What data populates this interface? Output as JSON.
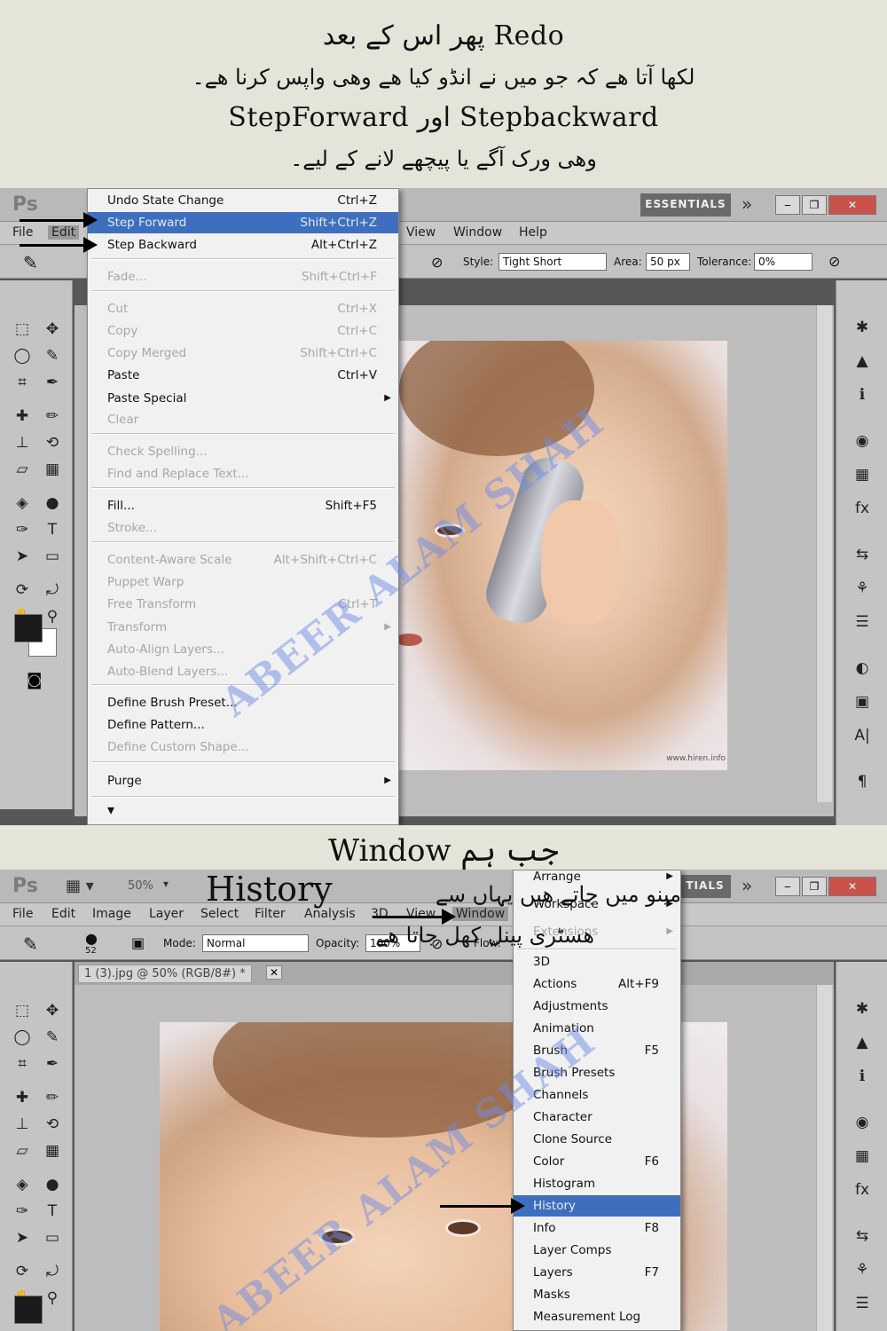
{
  "banner_top": {
    "line1": "Redo پھر اس کے بعد",
    "line2": "لکھا آتا ھے کہ جو میں نے انڈو کیا ھے وھی واپس کرنا ھے۔",
    "line3": "Stepbackward اور StepForward",
    "line4": "وھی ورک آگے یا پیچھے لانے کے لیے۔"
  },
  "screen1": {
    "app_logo": "Ps",
    "menubar": [
      "File",
      "Edit",
      "View",
      "Window",
      "Help"
    ],
    "workspace_button": "ESSENTIALS",
    "options_bar": {
      "style_label": "Style:",
      "style_value": "Tight Short",
      "area_label": "Area:",
      "area_value": "50 px",
      "tolerance_label": "Tolerance:",
      "tolerance_value": "0%"
    },
    "edit_menu": [
      {
        "label": "Undo State Change",
        "shortcut": "Ctrl+Z",
        "state": "normal"
      },
      {
        "label": "Step Forward",
        "shortcut": "Shift+Ctrl+Z",
        "state": "selected"
      },
      {
        "label": "Step Backward",
        "shortcut": "Alt+Ctrl+Z",
        "state": "normal"
      },
      {
        "label": "Fade...",
        "shortcut": "Shift+Ctrl+F",
        "state": "disabled"
      },
      {
        "label": "Cut",
        "shortcut": "Ctrl+X",
        "state": "disabled"
      },
      {
        "label": "Copy",
        "shortcut": "Ctrl+C",
        "state": "disabled"
      },
      {
        "label": "Copy Merged",
        "shortcut": "Shift+Ctrl+C",
        "state": "disabled"
      },
      {
        "label": "Paste",
        "shortcut": "Ctrl+V",
        "state": "normal"
      },
      {
        "label": "Paste Special",
        "shortcut": "",
        "state": "normal",
        "submenu": true
      },
      {
        "label": "Clear",
        "shortcut": "",
        "state": "disabled"
      },
      {
        "label": "Check Spelling...",
        "shortcut": "",
        "state": "disabled"
      },
      {
        "label": "Find and Replace Text...",
        "shortcut": "",
        "state": "disabled"
      },
      {
        "label": "Fill...",
        "shortcut": "Shift+F5",
        "state": "normal"
      },
      {
        "label": "Stroke...",
        "shortcut": "",
        "state": "disabled"
      },
      {
        "label": "Content-Aware Scale",
        "shortcut": "Alt+Shift+Ctrl+C",
        "state": "disabled"
      },
      {
        "label": "Puppet Warp",
        "shortcut": "",
        "state": "disabled"
      },
      {
        "label": "Free Transform",
        "shortcut": "Ctrl+T",
        "state": "disabled"
      },
      {
        "label": "Transform",
        "shortcut": "",
        "state": "disabled",
        "submenu": true
      },
      {
        "label": "Auto-Align Layers...",
        "shortcut": "",
        "state": "disabled"
      },
      {
        "label": "Auto-Blend Layers...",
        "shortcut": "",
        "state": "disabled"
      },
      {
        "label": "Define Brush Preset...",
        "shortcut": "",
        "state": "normal"
      },
      {
        "label": "Define Pattern...",
        "shortcut": "",
        "state": "normal"
      },
      {
        "label": "Define Custom Shape...",
        "shortcut": "",
        "state": "disabled"
      },
      {
        "label": "Purge",
        "shortcut": "",
        "state": "normal",
        "submenu": true
      }
    ],
    "watermark": "ABEER ALAM SHAH",
    "credit": "www.hiren.info"
  },
  "banner_middle": {
    "title": "جب ہم Window",
    "overlay1": "History",
    "overlay2": "مینو میں جاتے ھیں یہاں سے",
    "overlay3": "ھسٹری پینل کھل جاتا ھے"
  },
  "screen2": {
    "app_logo": "Ps",
    "zoom": "50%",
    "menubar": [
      "File",
      "Edit",
      "Image",
      "Layer",
      "Select",
      "Filter",
      "Analysis",
      "3D",
      "View",
      "Window"
    ],
    "workspace_button": "TIALS",
    "options_bar": {
      "brush_size": "52",
      "mode_label": "Mode:",
      "mode_value": "Normal",
      "opacity_label": "Opacity:",
      "opacity_value": "100%",
      "flow_label": "Flow:"
    },
    "doc_tab": "1 (3).jpg @ 50% (RGB/8#) *",
    "window_menu": [
      {
        "label": "Arrange",
        "shortcut": "",
        "submenu": true,
        "state": "normal"
      },
      {
        "label": "Workspace",
        "shortcut": "",
        "submenu": true,
        "state": "normal"
      },
      {
        "label": "Extensions",
        "shortcut": "",
        "submenu": true,
        "state": "disabled"
      },
      {
        "label": "3D",
        "shortcut": "",
        "state": "normal"
      },
      {
        "label": "Actions",
        "shortcut": "Alt+F9",
        "state": "normal"
      },
      {
        "label": "Adjustments",
        "shortcut": "",
        "state": "normal"
      },
      {
        "label": "Animation",
        "shortcut": "",
        "state": "normal"
      },
      {
        "label": "Brush",
        "shortcut": "F5",
        "state": "normal"
      },
      {
        "label": "Brush Presets",
        "shortcut": "",
        "state": "normal"
      },
      {
        "label": "Channels",
        "shortcut": "",
        "state": "normal"
      },
      {
        "label": "Character",
        "shortcut": "",
        "state": "normal"
      },
      {
        "label": "Clone Source",
        "shortcut": "",
        "state": "normal"
      },
      {
        "label": "Color",
        "shortcut": "F6",
        "state": "normal"
      },
      {
        "label": "Histogram",
        "shortcut": "",
        "state": "normal"
      },
      {
        "label": "History",
        "shortcut": "",
        "state": "selected"
      },
      {
        "label": "Info",
        "shortcut": "F8",
        "state": "normal"
      },
      {
        "label": "Layer Comps",
        "shortcut": "",
        "state": "normal"
      },
      {
        "label": "Layers",
        "shortcut": "F7",
        "state": "normal"
      },
      {
        "label": "Masks",
        "shortcut": "",
        "state": "normal"
      },
      {
        "label": "Measurement Log",
        "shortcut": "",
        "state": "normal"
      }
    ],
    "watermark": "ABEER ALAM SHAH"
  },
  "icons": {
    "tools": [
      "marquee-icon",
      "move-icon",
      "lasso-icon",
      "quick-select-icon",
      "crop-icon",
      "eyedropper-icon",
      "healing-icon",
      "brush-icon",
      "stamp-icon",
      "history-brush-icon",
      "eraser-icon",
      "gradient-icon",
      "blur-icon",
      "dodge-icon",
      "pen-icon",
      "type-icon",
      "path-select-icon",
      "shape-icon",
      "3d-rotate-icon",
      "3d-orbit-icon",
      "hand-icon",
      "zoom-icon"
    ],
    "tool_glyphs": [
      "⬚",
      "✥",
      "◯",
      "✎",
      "⌗",
      "✒",
      "✚",
      "✏",
      "⊥",
      "⟲",
      "▱",
      "▦",
      "◈",
      "●",
      "✑",
      "T",
      "➤",
      "▭",
      "⟳",
      "⤾",
      "✋",
      "⚲"
    ],
    "right_glyphs": [
      "✱",
      "▲",
      "ℹ",
      "◉",
      "▦",
      "fx",
      "⇆",
      "⚘",
      "☰",
      "◐",
      "▣",
      "A|",
      "¶"
    ]
  },
  "colors": {
    "menu_highlight": "#3e6fbf",
    "workspace_bg": "#575757",
    "watermark": "#6e8ce6"
  }
}
